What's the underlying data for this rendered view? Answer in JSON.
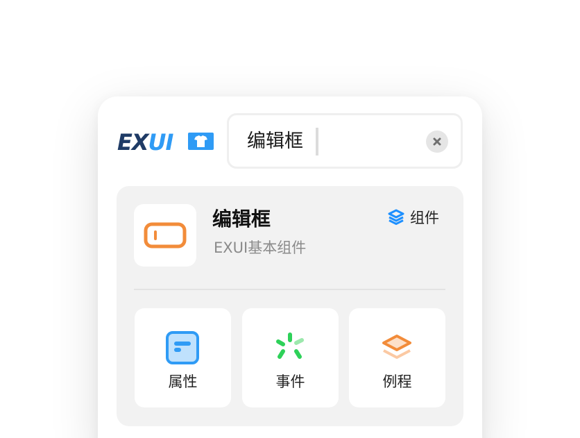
{
  "brand": {
    "logo_text": "EXUI"
  },
  "search": {
    "value": "编辑框"
  },
  "result": {
    "title": "编辑框",
    "subtitle": "EXUI基本组件",
    "badge_label": "组件"
  },
  "actions": [
    {
      "label": "属性",
      "icon": "properties-icon"
    },
    {
      "label": "事件",
      "icon": "events-icon"
    },
    {
      "label": "例程",
      "icon": "examples-icon"
    }
  ],
  "colors": {
    "brand_navy": "#1f3b66",
    "brand_blue": "#2f9bf5",
    "orange": "#f28c3a",
    "green": "#2ed159",
    "accent_blue": "#1e90ff"
  }
}
